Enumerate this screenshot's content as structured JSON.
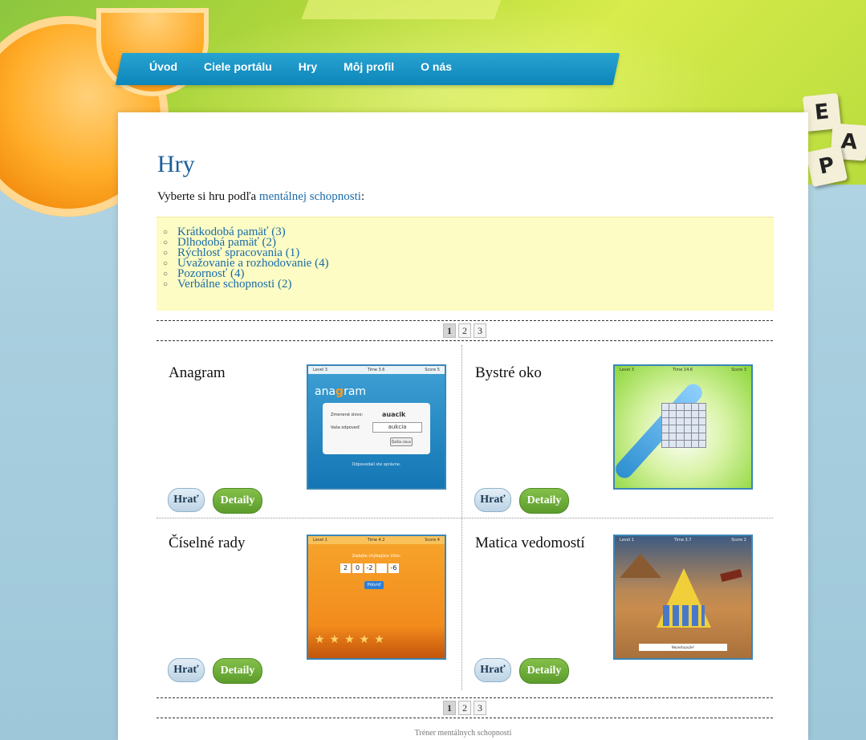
{
  "nav": {
    "items": [
      "Úvod",
      "Ciele portálu",
      "Hry",
      "Môj profil",
      "O nás"
    ]
  },
  "tiles": {
    "e": "E",
    "a": "A",
    "p": "P"
  },
  "page": {
    "title": "Hry",
    "intro_prefix": "Vyberte si hru podľa",
    "intro_link": "mentálnej schopnosti",
    "intro_suffix": ":"
  },
  "categories": [
    "Krátkodobá pamäť (3)",
    "Dlhodobá pamäť (2)",
    "Rýchlosť spracovania (1)",
    "Uvažovanie a rozhodovanie (4)",
    "Pozornosť (4)",
    "Verbálne schopnosti (2)"
  ],
  "pager": {
    "pages": [
      "1",
      "2",
      "3"
    ],
    "active": "1"
  },
  "games": [
    {
      "title": "Anagram",
      "play": "Hrať",
      "details": "Detaily"
    },
    {
      "title": "Bystré oko",
      "play": "Hrať",
      "details": "Detaily"
    },
    {
      "title": "Číselné rady",
      "play": "Hrať",
      "details": "Detaily"
    },
    {
      "title": "Matica vedomostí",
      "play": "Hrať",
      "details": "Detaily"
    }
  ],
  "thumbs": {
    "anagram": {
      "level": "Level 3",
      "time": "Time 3.6",
      "score": "Score 5",
      "logo_a": "ana",
      "logo_g": "g",
      "logo_b": "ram",
      "label1": "Zmenené slovo:",
      "word": "auacik",
      "label2": "Vaša odpoveď:",
      "answer": "aukcia",
      "button": "Ďalšie slovo",
      "msg": "Odpovedali ste správne."
    },
    "bystre": {
      "level": "Level 3",
      "time": "Time 14.6",
      "score": "Score 3"
    },
    "ciselne": {
      "level": "Level 1",
      "time": "Time 4.2",
      "score": "Score 4",
      "header": "Zadajte chýbajúce číslo:",
      "nums": [
        "2",
        "0",
        "-2",
        "",
        "-6"
      ],
      "button": "Potvrď"
    },
    "matica": {
      "level": "Level 1",
      "time": "Time 3.7",
      "score": "Score 2",
      "strip": "Nepostupujte!"
    }
  },
  "footer": "Tréner mentálnych schopností"
}
